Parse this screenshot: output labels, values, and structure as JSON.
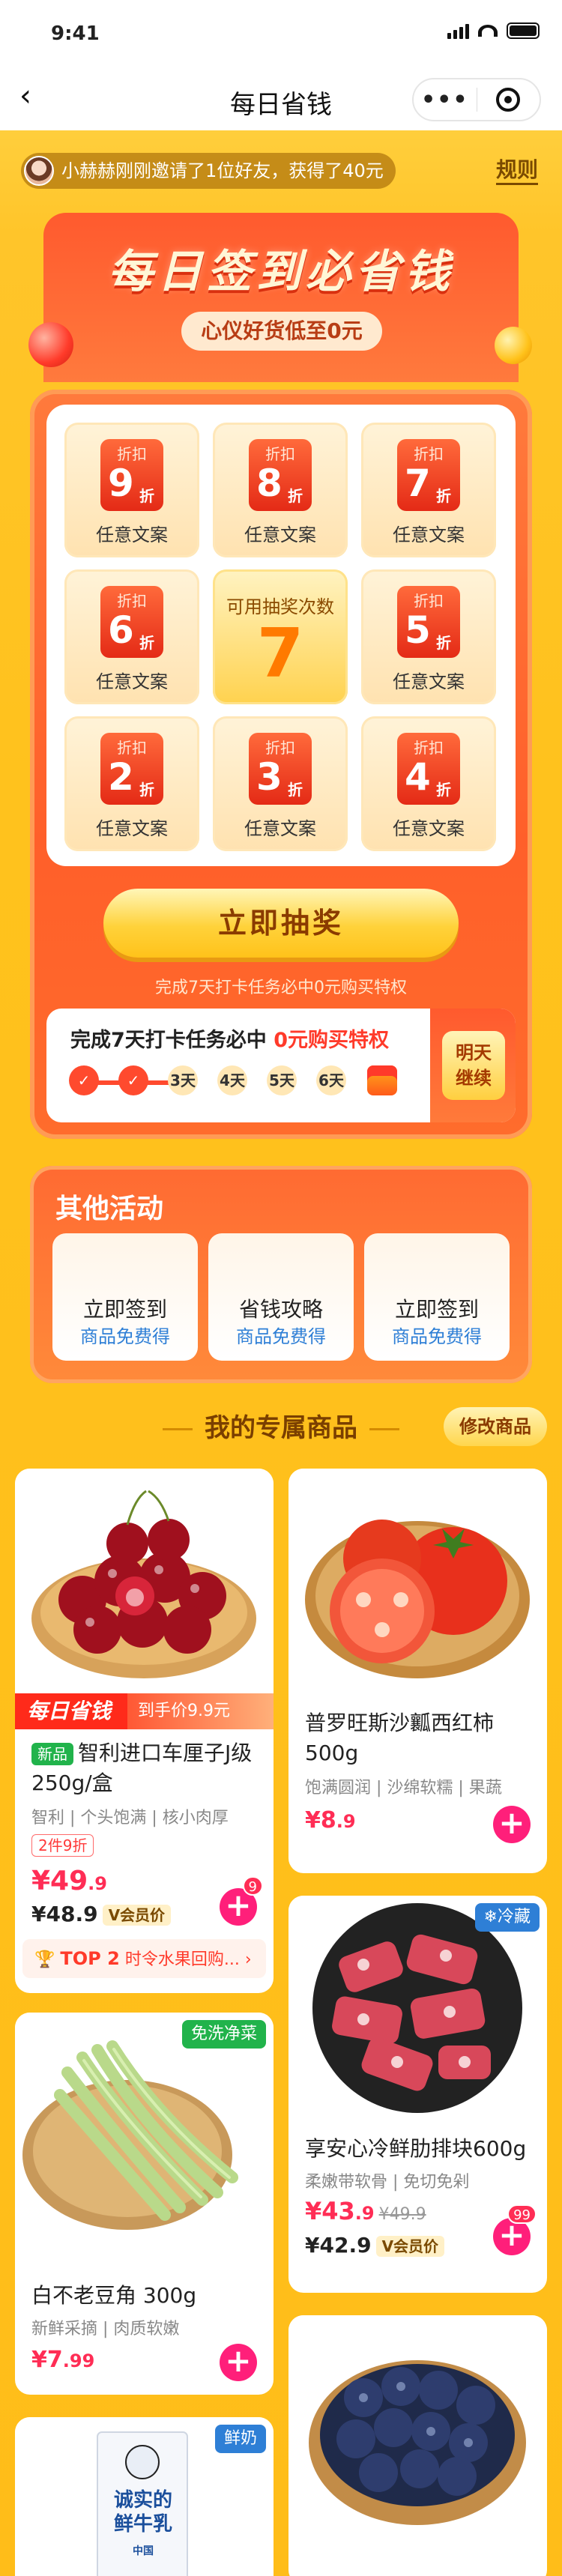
{
  "status_bar": {
    "time": "9:41"
  },
  "nav": {
    "title": "每日省钱",
    "more": "•••"
  },
  "notice": {
    "text": "小赫赫刚刚邀请了1位好友，获得了40元",
    "rules": "规则"
  },
  "hero": {
    "title": "每日签到必省钱",
    "subtitle": "心仪好货低至0元"
  },
  "lottery": {
    "cells": [
      {
        "label": "折扣",
        "num": "9",
        "unit": "折",
        "text": "任意文案"
      },
      {
        "label": "折扣",
        "num": "8",
        "unit": "折",
        "text": "任意文案"
      },
      {
        "label": "折扣",
        "num": "7",
        "unit": "折",
        "text": "任意文案"
      },
      {
        "label": "折扣",
        "num": "6",
        "unit": "折",
        "text": "任意文案"
      },
      {
        "label": "折扣",
        "num": "5",
        "unit": "折",
        "text": "任意文案"
      },
      {
        "label": "折扣",
        "num": "2",
        "unit": "折",
        "text": "任意文案"
      },
      {
        "label": "折扣",
        "num": "3",
        "unit": "折",
        "text": "任意文案"
      },
      {
        "label": "折扣",
        "num": "4",
        "unit": "折",
        "text": "任意文案"
      }
    ],
    "center_title": "可用抽奖次数",
    "center_count": "7",
    "draw_button": "立即抽奖",
    "draw_note": "完成7天打卡任务必中0元购买特权"
  },
  "task": {
    "title_prefix": "完成7天打卡任务必中 ",
    "title_highlight": "0元购买特权",
    "steps": [
      "3天",
      "4天",
      "5天",
      "6天"
    ],
    "side_button_line1": "明天",
    "side_button_line2": "继续"
  },
  "other": {
    "title": "其他活动",
    "cards": [
      {
        "title": "立即签到",
        "sub": "商品免费得"
      },
      {
        "title": "省钱攻略",
        "sub": "商品免费得"
      },
      {
        "title": "立即签到",
        "sub": "商品免费得"
      }
    ]
  },
  "my_products": {
    "title": "我的专属商品",
    "modify": "修改商品"
  },
  "products": {
    "cherry": {
      "banner_left": "每日省钱",
      "banner_right": "到手价9.9元",
      "new_tag": "新品",
      "title": "智利进口车厘子J级250g/盒",
      "desc": "智利 | 个头饱满 | 核小肉厚",
      "limit": "2件9折",
      "price_main": "¥49",
      "price_dec": ".9",
      "vip_price": "¥48.9",
      "vip_tag": "V会员价",
      "count": "9",
      "rank_top": "TOP 2",
      "rank_text": "时令水果回购..."
    },
    "tomato": {
      "title": "普罗旺斯沙瓤西红柿500g",
      "desc": "饱满圆润 | 沙绵软糯 | 果蔬",
      "price_main": "¥8",
      "price_dec": ".9"
    },
    "bean": {
      "badge": "免洗净菜",
      "title": "白不老豆角 300g",
      "desc": "新鲜采摘 | 肉质软嫩",
      "price_main": "¥7",
      "price_dec": ".99"
    },
    "ribs": {
      "badge": "冷藏",
      "title": "享安心冷鲜肋排块600g",
      "desc": "柔嫩带软骨 | 免切免剁",
      "price_main": "¥43",
      "price_dec": ".9",
      "old_price": "¥49.9",
      "vip_price": "¥42.9",
      "vip_tag": "V会员价",
      "count": "99"
    },
    "milk": {
      "badge": "鲜奶",
      "pack_text_1": "诚实的",
      "pack_text_2": "鲜牛乳",
      "pack_text_3": "中国"
    }
  },
  "colors": {
    "accent_red": "#ff3a2a",
    "price_pink": "#ff2d55",
    "add_button": "#ff1f7a",
    "bg_yellow": "#ffc21d"
  }
}
